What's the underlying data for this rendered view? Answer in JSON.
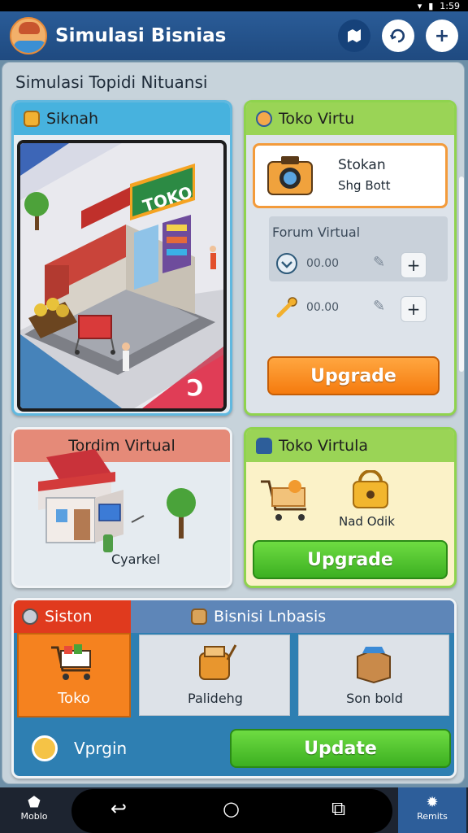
{
  "statusbar": {
    "time": "1:59"
  },
  "header": {
    "title": "Simulasi Bisnias"
  },
  "section": {
    "title": "Simulasi Topidi Nituansi"
  },
  "card_siknah": {
    "title": "Siknah",
    "sign": "TOKO"
  },
  "card_toko_virtu": {
    "title": "Toko Virtu",
    "item": {
      "line1": "Stokan",
      "line2": "Shg Bott"
    },
    "sub_title": "Forum Virtual",
    "rows": [
      {
        "icon": "check-icon",
        "value": "00.00"
      },
      {
        "icon": "key-icon",
        "value": "00.00"
      }
    ],
    "button": "Upgrade"
  },
  "card_tordim": {
    "title": "Tordim Virtual",
    "caption": "Cyarkel"
  },
  "card_toko_virtula": {
    "title": "Toko Virtula",
    "caption": "Nad Odik",
    "button": "Upgrade"
  },
  "card_bottom": {
    "tab_active": "Siston",
    "tab_title": "Bisnisi Lnbasis",
    "tiles": [
      {
        "label": "Toko"
      },
      {
        "label": "Palidehg"
      },
      {
        "label": "Son bold"
      }
    ],
    "footer_label": "Vprgin",
    "button": "Update"
  },
  "navbar": {
    "left_label": "Moblo",
    "right_label": "Remits"
  },
  "colors": {
    "accent_orange": "#f57b0e",
    "accent_green": "#3cb021",
    "header_blue": "#1f4a80"
  }
}
